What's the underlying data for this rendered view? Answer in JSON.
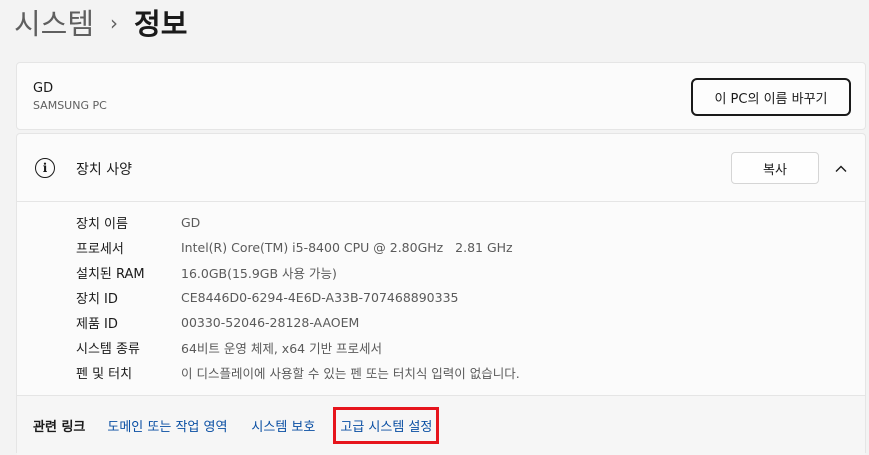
{
  "breadcrumb": {
    "parent": "시스템",
    "separator": "›",
    "current": "정보"
  },
  "pc": {
    "name": "GD",
    "model": "SAMSUNG PC",
    "rename_button": "이 PC의 이름 바꾸기"
  },
  "device_specs": {
    "title": "장치 사양",
    "copy_button": "복사",
    "icon": "info-icon",
    "rows": [
      {
        "label": "장치 이름",
        "value": "GD"
      },
      {
        "label": "프로세서",
        "value": "Intel(R) Core(TM) i5-8400 CPU @ 2.80GHz   2.81 GHz"
      },
      {
        "label": "설치된 RAM",
        "value": "16.0GB(15.9GB 사용 가능)"
      },
      {
        "label": "장치 ID",
        "value": "CE8446D0-6294-4E6D-A33B-707468890335"
      },
      {
        "label": "제품 ID",
        "value": "00330-52046-28128-AAOEM"
      },
      {
        "label": "시스템 종류",
        "value": "64비트 운영 체제, x64 기반 프로세서"
      },
      {
        "label": "펜 및 터치",
        "value": "이 디스플레이에 사용할 수 있는 펜 또는 터치식 입력이 없습니다."
      }
    ]
  },
  "related": {
    "label": "관련 링크",
    "links": [
      {
        "label": "도메인 또는 작업 영역"
      },
      {
        "label": "시스템 보호"
      },
      {
        "label": "고급 시스템 설정"
      }
    ],
    "highlight_color": "#e6141c",
    "link_color": "#0a4fa3"
  }
}
